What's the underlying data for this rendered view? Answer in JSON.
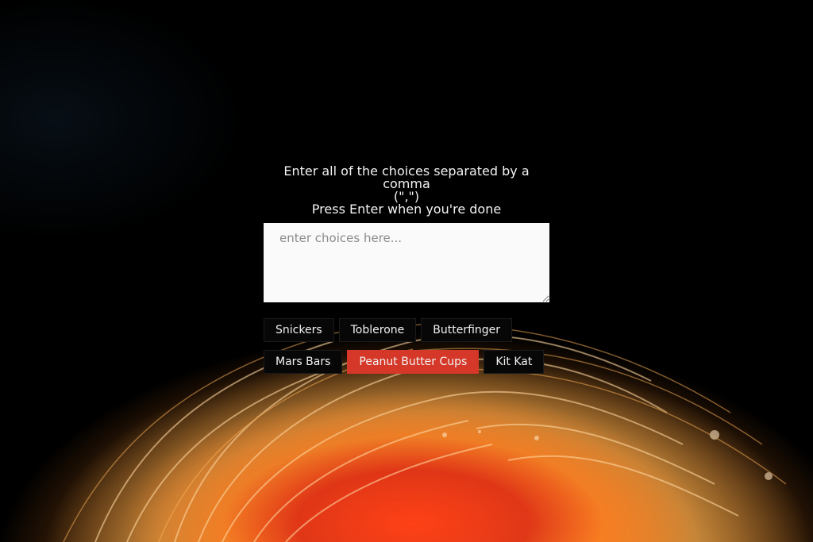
{
  "instructions": {
    "line1": "Enter all of the choices separated by a comma",
    "line2": "(\",\")",
    "line3": "Press Enter when you're done"
  },
  "input": {
    "value": "",
    "placeholder": "enter choices here..."
  },
  "choices": [
    {
      "label": "Snickers",
      "selected": false
    },
    {
      "label": "Toblerone",
      "selected": false
    },
    {
      "label": "Butterfinger",
      "selected": false
    },
    {
      "label": "Mars Bars",
      "selected": false
    },
    {
      "label": "Peanut Butter Cups",
      "selected": true
    },
    {
      "label": "Kit Kat",
      "selected": false
    }
  ],
  "colors": {
    "selected_chip": "#d53828",
    "chip_bg": "#070707",
    "background": "#000000",
    "text": "#f2f2f2"
  },
  "icons": {
    "resize_handle": "resize-grip-icon"
  }
}
